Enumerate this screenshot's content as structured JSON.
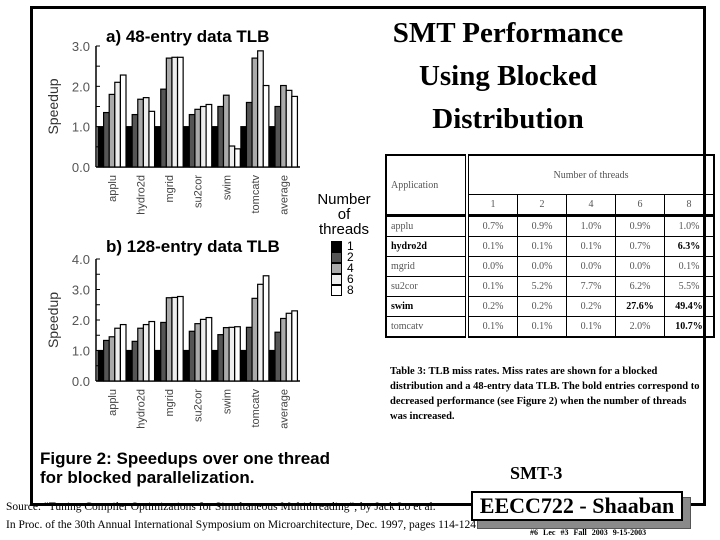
{
  "slide": {
    "title_lines": [
      "SMT Performance",
      "Using Blocked",
      "Distribution"
    ],
    "slide_number": "SMT-3",
    "badge": "EECC722 - Shaaban",
    "source_lines": [
      "Source:  \"Tuning Compiler Optimizations for Simultaneous Multithreading\", by Jack Lo et al.",
      "In Proc. of the 30th Annual International Symposium on Microarchitecture, Dec. 1997, pages 114-124"
    ],
    "footer_meta": "#6  Lec #3  Fall 2003  9-15-2003",
    "figure_caption_lines": [
      "Figure 2: Speedups over one thread",
      "for blocked parallelization."
    ]
  },
  "legend": {
    "title_lines": [
      "Number",
      "of",
      "threads"
    ],
    "entries": [
      {
        "label": "1",
        "color": "#000000"
      },
      {
        "label": "2",
        "color": "#555555"
      },
      {
        "label": "4",
        "color": "#aaaaaa"
      },
      {
        "label": "6",
        "color": "#eeeeee"
      },
      {
        "label": "8",
        "color": "#ffffff"
      }
    ]
  },
  "chart_data": [
    {
      "type": "bar",
      "title": "a) 48-entry data TLB",
      "xlabel": "",
      "ylabel": "Speedup",
      "ylim": [
        0,
        3.0
      ],
      "yticks": [
        "0.0",
        "1.0",
        "2.0",
        "3.0"
      ],
      "ytick_values": [
        0,
        1,
        2,
        3
      ],
      "minor_step": 0.5,
      "categories": [
        "applu",
        "hydro2d",
        "mgrid",
        "su2cor",
        "swim",
        "tomcatv",
        "average"
      ],
      "series": [
        {
          "name": "1",
          "values": [
            1.0,
            1.0,
            1.0,
            1.0,
            1.0,
            1.0,
            1.0
          ]
        },
        {
          "name": "2",
          "values": [
            1.35,
            1.3,
            1.93,
            1.3,
            1.5,
            1.6,
            1.5
          ]
        },
        {
          "name": "4",
          "values": [
            1.8,
            1.68,
            2.7,
            1.43,
            1.78,
            2.7,
            2.02
          ]
        },
        {
          "name": "6",
          "values": [
            2.1,
            1.72,
            2.72,
            1.5,
            0.52,
            2.88,
            1.9
          ]
        },
        {
          "name": "8",
          "values": [
            2.28,
            1.38,
            2.72,
            1.55,
            0.45,
            2.02,
            1.75
          ]
        }
      ]
    },
    {
      "type": "bar",
      "title": "b) 128-entry data TLB",
      "xlabel": "",
      "ylabel": "Speedup",
      "ylim": [
        0,
        4.0
      ],
      "yticks": [
        "0.0",
        "1.0",
        "2.0",
        "3.0",
        "4.0"
      ],
      "ytick_values": [
        0,
        1,
        2,
        3,
        4
      ],
      "minor_step": 0.5,
      "categories": [
        "applu",
        "hydro2d",
        "mgrid",
        "su2cor",
        "swim",
        "tomcatv",
        "average"
      ],
      "series": [
        {
          "name": "1",
          "values": [
            1.0,
            1.0,
            1.0,
            1.0,
            1.0,
            1.0,
            1.0
          ]
        },
        {
          "name": "2",
          "values": [
            1.33,
            1.3,
            1.92,
            1.63,
            1.52,
            1.76,
            1.6
          ]
        },
        {
          "name": "4",
          "values": [
            1.45,
            1.73,
            2.73,
            1.88,
            1.75,
            2.71,
            2.05
          ]
        },
        {
          "name": "6",
          "values": [
            1.73,
            1.85,
            2.74,
            2.02,
            1.76,
            3.17,
            2.22
          ]
        },
        {
          "name": "8",
          "values": [
            1.85,
            1.95,
            2.77,
            2.08,
            1.78,
            3.45,
            2.3
          ]
        }
      ]
    }
  ],
  "table": {
    "group_header": "Number of threads",
    "app_header": "Application",
    "thread_headers": [
      "1",
      "2",
      "4",
      "6",
      "8"
    ],
    "rows": [
      {
        "app": "applu",
        "app_bold": false,
        "cells": [
          {
            "v": "0.7%",
            "b": false
          },
          {
            "v": "0.9%",
            "b": false
          },
          {
            "v": "1.0%",
            "b": false
          },
          {
            "v": "0.9%",
            "b": false
          },
          {
            "v": "1.0%",
            "b": false
          }
        ]
      },
      {
        "app": "hydro2d",
        "app_bold": true,
        "cells": [
          {
            "v": "0.1%",
            "b": false
          },
          {
            "v": "0.1%",
            "b": false
          },
          {
            "v": "0.1%",
            "b": false
          },
          {
            "v": "0.7%",
            "b": false
          },
          {
            "v": "6.3%",
            "b": true
          }
        ]
      },
      {
        "app": "mgrid",
        "app_bold": false,
        "cells": [
          {
            "v": "0.0%",
            "b": false
          },
          {
            "v": "0.0%",
            "b": false
          },
          {
            "v": "0.0%",
            "b": false
          },
          {
            "v": "0.0%",
            "b": false
          },
          {
            "v": "0.1%",
            "b": false
          }
        ]
      },
      {
        "app": "su2cor",
        "app_bold": false,
        "cells": [
          {
            "v": "0.1%",
            "b": false
          },
          {
            "v": "5.2%",
            "b": false
          },
          {
            "v": "7.7%",
            "b": false
          },
          {
            "v": "6.2%",
            "b": false
          },
          {
            "v": "5.5%",
            "b": false
          }
        ]
      },
      {
        "app": "swim",
        "app_bold": true,
        "cells": [
          {
            "v": "0.2%",
            "b": false
          },
          {
            "v": "0.2%",
            "b": false
          },
          {
            "v": "0.2%",
            "b": false
          },
          {
            "v": "27.6%",
            "b": true
          },
          {
            "v": "49.4%",
            "b": true
          }
        ]
      },
      {
        "app": "tomcatv",
        "app_bold": false,
        "cells": [
          {
            "v": "0.1%",
            "b": false
          },
          {
            "v": "0.1%",
            "b": false
          },
          {
            "v": "0.1%",
            "b": false
          },
          {
            "v": "2.0%",
            "b": false
          },
          {
            "v": "10.7%",
            "b": true
          }
        ]
      }
    ],
    "caption": "Table 3: TLB miss rates. Miss rates are shown for a blocked distribution and a 48-entry data TLB. The bold entries correspond to decreased performance (see Figure 2) when the number of threads was increased."
  }
}
